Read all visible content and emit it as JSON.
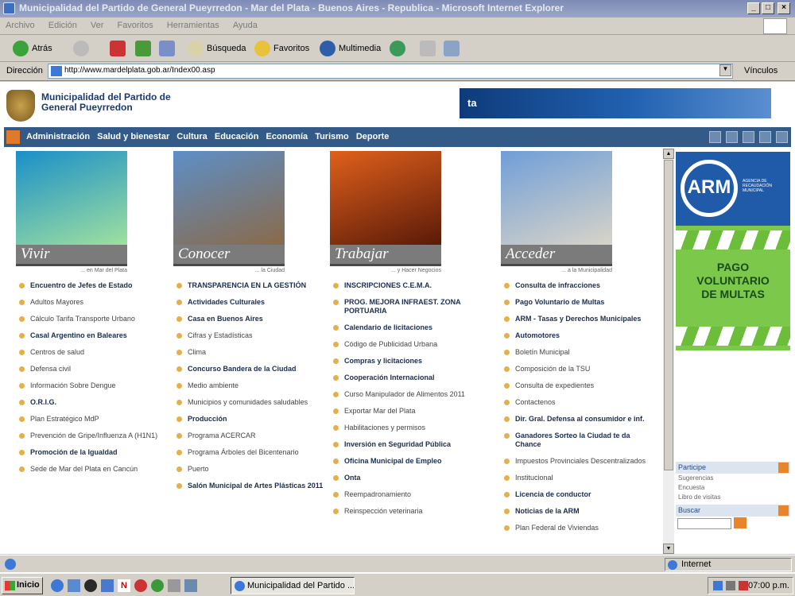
{
  "window": {
    "title": "Municipalidad del Partido de General Pueyrredon - Mar del Plata - Buenos Aires - Republica - Microsoft Internet Explorer",
    "minimize": "_",
    "maximize": "□",
    "close": "×"
  },
  "menu": [
    "Archivo",
    "Edición",
    "Ver",
    "Favoritos",
    "Herramientas",
    "Ayuda"
  ],
  "toolbar": {
    "back": "Atrás",
    "search": "Búsqueda",
    "favorites": "Favoritos",
    "media": "Multimedia"
  },
  "address": {
    "label": "Dirección",
    "url": "http://www.mardelplata.gob.ar/Index00.asp",
    "links": "Vínculos"
  },
  "site": {
    "title": "Municipalidad del Partido de General Pueyrredon",
    "banner_text": "ta"
  },
  "nav": [
    "Administración",
    "Salud y bienestar",
    "Cultura",
    "Educación",
    "Economía",
    "Turismo",
    "Deporte"
  ],
  "columns": [
    {
      "label": "Vivir",
      "tag": "... en Mar del Plata",
      "photo_colors": [
        "#1a8fc9",
        "#9fe0a0"
      ],
      "items": [
        {
          "t": "Encuentro de Jefes de Estado",
          "b": true
        },
        {
          "t": "Adultos Mayores",
          "b": false
        },
        {
          "t": "Cálculo Tarifa Transporte Urbano",
          "b": false
        },
        {
          "t": "Casal Argentino en Baleares",
          "b": true
        },
        {
          "t": "Centros de salud",
          "b": false
        },
        {
          "t": "Defensa civil",
          "b": false
        },
        {
          "t": "Información Sobre Dengue",
          "b": false
        },
        {
          "t": "O.R.I.G.",
          "b": true
        },
        {
          "t": "Plan Estratégico MdP",
          "b": false
        },
        {
          "t": "Prevención de Gripe/Influenza A (H1N1)",
          "b": false
        },
        {
          "t": "Promoción de la Igualdad",
          "b": true
        },
        {
          "t": "Sede de Mar del Plata en Cancún",
          "b": false
        }
      ]
    },
    {
      "label": "Conocer",
      "tag": "... la Ciudad",
      "photo_colors": [
        "#5d8fc8",
        "#8a6a4a"
      ],
      "items": [
        {
          "t": "TRANSPARENCIA EN LA GESTIÓN",
          "b": true
        },
        {
          "t": "Actividades Culturales",
          "b": true
        },
        {
          "t": "Casa en Buenos Aires",
          "b": true
        },
        {
          "t": "Cifras y Estadísticas",
          "b": false
        },
        {
          "t": "Clima",
          "b": false
        },
        {
          "t": "Concurso Bandera de la Ciudad",
          "b": true
        },
        {
          "t": "Medio ambiente",
          "b": false
        },
        {
          "t": "Municipios y comunidades saludables",
          "b": false
        },
        {
          "t": "Producción",
          "b": true
        },
        {
          "t": "Programa ACERCAR",
          "b": false
        },
        {
          "t": "Programa Árboles del Bicentenario",
          "b": false
        },
        {
          "t": "Puerto",
          "b": false
        },
        {
          "t": "Salón Municipal de Artes Plásticas 2011",
          "b": true
        }
      ]
    },
    {
      "label": "Trabajar",
      "tag": "... y Hacer Negocios",
      "photo_colors": [
        "#e0601c",
        "#5a1a08"
      ],
      "items": [
        {
          "t": "INSCRIPCIONES C.E.M.A.",
          "b": true
        },
        {
          "t": "PROG. MEJORA INFRAEST. ZONA PORTUARIA",
          "b": true
        },
        {
          "t": "Calendario de licitaciones",
          "b": true
        },
        {
          "t": "Código de Publicidad Urbana",
          "b": false
        },
        {
          "t": "Compras y licitaciones",
          "b": true
        },
        {
          "t": "Cooperación Internacional",
          "b": true
        },
        {
          "t": "Curso Manipulador de Alimentos 2011",
          "b": false
        },
        {
          "t": "Exportar Mar del Plata",
          "b": false
        },
        {
          "t": "Habilitaciones y permisos",
          "b": false
        },
        {
          "t": "Inversión en Seguridad Pública",
          "b": true
        },
        {
          "t": "Oficina Municipal de Empleo",
          "b": true
        },
        {
          "t": "Onta",
          "b": true
        },
        {
          "t": "Reempadronamiento",
          "b": false
        },
        {
          "t": "Reinspección veterinaria",
          "b": false
        }
      ]
    },
    {
      "label": "Acceder",
      "tag": "... a la Municipalidad",
      "photo_colors": [
        "#6f9ed8",
        "#d8d4c8"
      ],
      "items": [
        {
          "t": "Consulta de infracciones",
          "b": true
        },
        {
          "t": "Pago Voluntario de Multas",
          "b": true
        },
        {
          "t": "ARM - Tasas y Derechos Municipales",
          "b": true
        },
        {
          "t": "Automotores",
          "b": true
        },
        {
          "t": "Boletín Municipal",
          "b": false
        },
        {
          "t": "Composición de la TSU",
          "b": false
        },
        {
          "t": "Consulta de expedientes",
          "b": false
        },
        {
          "t": "Contactenos",
          "b": false
        },
        {
          "t": "Dir. Gral. Defensa al consumidor e inf.",
          "b": true
        },
        {
          "t": "Ganadores Sorteo la Ciudad te da Chance",
          "b": true
        },
        {
          "t": "Impuestos Provinciales Descentralizados",
          "b": false
        },
        {
          "t": "Institucional",
          "b": false
        },
        {
          "t": "Licencia de conductor",
          "b": true
        },
        {
          "t": "Noticias de la ARM",
          "b": true
        },
        {
          "t": "Plan Federal de Viviendas",
          "b": false
        }
      ]
    }
  ],
  "arm": {
    "logo": "ARM",
    "subtitle": "AGENCIA DE RECAUDACIÓN MUNICIPAL"
  },
  "pago": {
    "line1": "PAGO",
    "line2": "VOLUNTARIO",
    "line3": "DE MULTAS"
  },
  "sidebar": {
    "participe": "Participe",
    "links": [
      "Sugerencias",
      "Encuesta",
      "Libro de visitas"
    ],
    "buscar": "Buscar"
  },
  "status": {
    "zone": "Internet"
  },
  "taskbar": {
    "start": "Inicio",
    "task": "Municipalidad del Partido ...",
    "clock": "07:00 p.m."
  }
}
